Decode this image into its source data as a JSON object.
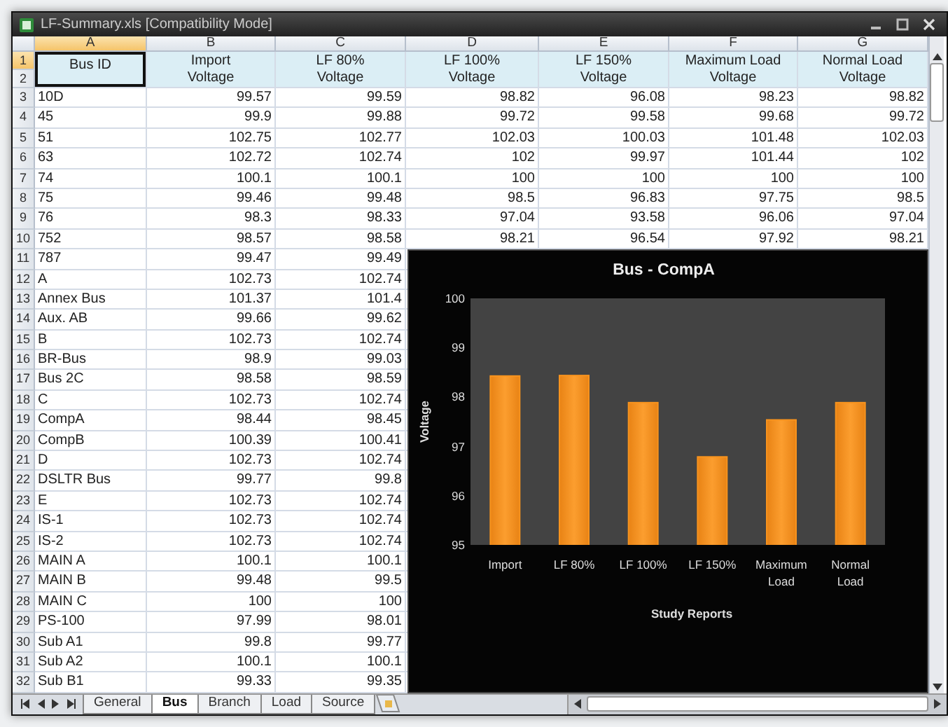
{
  "window": {
    "title": "LF-Summary.xls  [Compatibility Mode]"
  },
  "sheet": {
    "columns": [
      {
        "letter": "A",
        "selected": true
      },
      {
        "letter": "B",
        "selected": false
      },
      {
        "letter": "C",
        "selected": false
      },
      {
        "letter": "D",
        "selected": false
      },
      {
        "letter": "E",
        "selected": false
      },
      {
        "letter": "F",
        "selected": false
      },
      {
        "letter": "G",
        "selected": false
      }
    ],
    "header_rows": [
      {
        "number": "1",
        "selected": true
      },
      {
        "number": "2",
        "selected": false
      }
    ],
    "headers": [
      {
        "text": "Bus ID",
        "selected": true
      },
      {
        "text": "Import\nVoltage",
        "selected": false
      },
      {
        "text": "LF 80%\nVoltage",
        "selected": false
      },
      {
        "text": "LF 100%\nVoltage",
        "selected": false
      },
      {
        "text": "LF 150%\nVoltage",
        "selected": false
      },
      {
        "text": "Maximum Load\nVoltage",
        "selected": false
      },
      {
        "text": "Normal Load\nVoltage",
        "selected": false
      }
    ],
    "rows": [
      {
        "number": "3",
        "cells": [
          "10D",
          "99.57",
          "99.59",
          "98.82",
          "96.08",
          "98.23",
          "98.82"
        ]
      },
      {
        "number": "4",
        "cells": [
          "45",
          "99.9",
          "99.88",
          "99.72",
          "99.58",
          "99.68",
          "99.72"
        ]
      },
      {
        "number": "5",
        "cells": [
          "51",
          "102.75",
          "102.77",
          "102.03",
          "100.03",
          "101.48",
          "102.03"
        ]
      },
      {
        "number": "6",
        "cells": [
          "63",
          "102.72",
          "102.74",
          "102",
          "99.97",
          "101.44",
          "102"
        ]
      },
      {
        "number": "7",
        "cells": [
          "74",
          "100.1",
          "100.1",
          "100",
          "100",
          "100",
          "100"
        ]
      },
      {
        "number": "8",
        "cells": [
          "75",
          "99.46",
          "99.48",
          "98.5",
          "96.83",
          "97.75",
          "98.5"
        ]
      },
      {
        "number": "9",
        "cells": [
          "76",
          "98.3",
          "98.33",
          "97.04",
          "93.58",
          "96.06",
          "97.04"
        ]
      },
      {
        "number": "10",
        "cells": [
          "752",
          "98.57",
          "98.58",
          "98.21",
          "96.54",
          "97.92",
          "98.21"
        ]
      },
      {
        "number": "11",
        "cells": [
          "787",
          "99.47",
          "99.49"
        ]
      },
      {
        "number": "12",
        "cells": [
          "A",
          "102.73",
          "102.74"
        ]
      },
      {
        "number": "13",
        "cells": [
          "Annex Bus",
          "101.37",
          "101.4"
        ]
      },
      {
        "number": "14",
        "cells": [
          "Aux. AB",
          "99.66",
          "99.62"
        ]
      },
      {
        "number": "15",
        "cells": [
          "B",
          "102.73",
          "102.74"
        ]
      },
      {
        "number": "16",
        "cells": [
          "BR-Bus",
          "98.9",
          "99.03"
        ]
      },
      {
        "number": "17",
        "cells": [
          "Bus 2C",
          "98.58",
          "98.59"
        ]
      },
      {
        "number": "18",
        "cells": [
          "C",
          "102.73",
          "102.74"
        ]
      },
      {
        "number": "19",
        "cells": [
          "CompA",
          "98.44",
          "98.45"
        ]
      },
      {
        "number": "20",
        "cells": [
          "CompB",
          "100.39",
          "100.41"
        ]
      },
      {
        "number": "21",
        "cells": [
          "D",
          "102.73",
          "102.74"
        ]
      },
      {
        "number": "22",
        "cells": [
          "DSLTR Bus",
          "99.77",
          "99.8"
        ]
      },
      {
        "number": "23",
        "cells": [
          "E",
          "102.73",
          "102.74"
        ]
      },
      {
        "number": "24",
        "cells": [
          "IS-1",
          "102.73",
          "102.74"
        ]
      },
      {
        "number": "25",
        "cells": [
          "IS-2",
          "102.73",
          "102.74"
        ]
      },
      {
        "number": "26",
        "cells": [
          "MAIN A",
          "100.1",
          "100.1"
        ]
      },
      {
        "number": "27",
        "cells": [
          "MAIN B",
          "99.48",
          "99.5"
        ]
      },
      {
        "number": "28",
        "cells": [
          "MAIN C",
          "100",
          "100"
        ]
      },
      {
        "number": "29",
        "cells": [
          "PS-100",
          "97.99",
          "98.01"
        ]
      },
      {
        "number": "30",
        "cells": [
          "Sub A1",
          "99.8",
          "99.77"
        ]
      },
      {
        "number": "31",
        "cells": [
          "Sub A2",
          "100.1",
          "100.1"
        ]
      },
      {
        "number": "32",
        "cells": [
          "Sub B1",
          "99.33",
          "99.35"
        ]
      }
    ],
    "chart_data": {
      "type": "bar",
      "title": "Bus - CompA",
      "xlabel": "Study Reports",
      "ylabel": "Voltage",
      "categories": [
        "Import",
        "LF 80%",
        "LF 100%",
        "LF 150%",
        "Maximum Load",
        "Normal Load"
      ],
      "series": [
        {
          "color": "#f7931e",
          "values": [
            98.44,
            98.45,
            97.9,
            96.8,
            97.55,
            97.9
          ]
        }
      ],
      "ylim": [
        95,
        100
      ],
      "yticks": [
        95,
        96,
        97,
        98,
        99,
        100
      ]
    }
  },
  "sheet_tabs": [
    {
      "label": "General",
      "selected": false
    },
    {
      "label": "Bus",
      "selected": true
    },
    {
      "label": "Branch",
      "selected": false
    },
    {
      "label": "Load",
      "selected": false
    },
    {
      "label": "Source",
      "selected": false
    }
  ]
}
